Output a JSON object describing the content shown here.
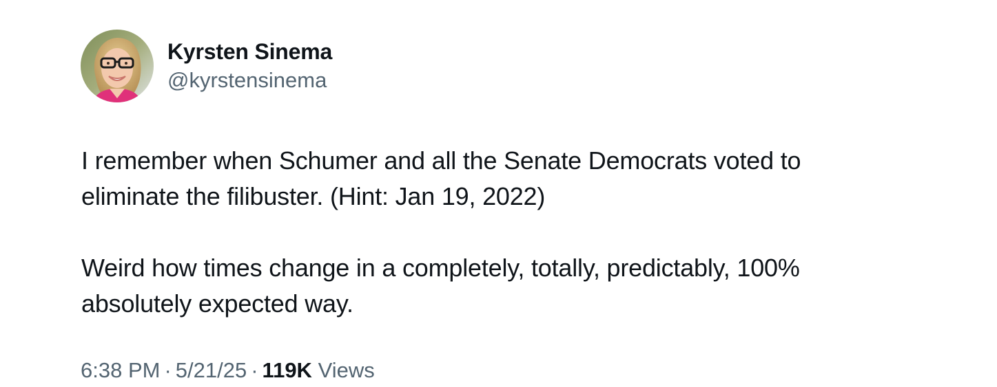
{
  "author": {
    "display_name": "Kyrsten Sinema",
    "handle": "@kyrstensinema"
  },
  "tweet": {
    "paragraphs": [
      "I remember when Schumer and all the Senate Democrats voted to\neliminate the filibuster. (Hint: Jan 19, 2022)",
      "Weird how times change in a completely, totally, predictably, 100%\nabsolutely expected way."
    ]
  },
  "meta": {
    "time": "6:38 PM",
    "date": "5/21/25",
    "separator": "·",
    "views_count": "119K",
    "views_label": "Views"
  },
  "colors": {
    "text_primary": "#0f1419",
    "text_secondary": "#536471",
    "background": "#ffffff"
  },
  "icons": {
    "avatar": "profile-photo"
  }
}
